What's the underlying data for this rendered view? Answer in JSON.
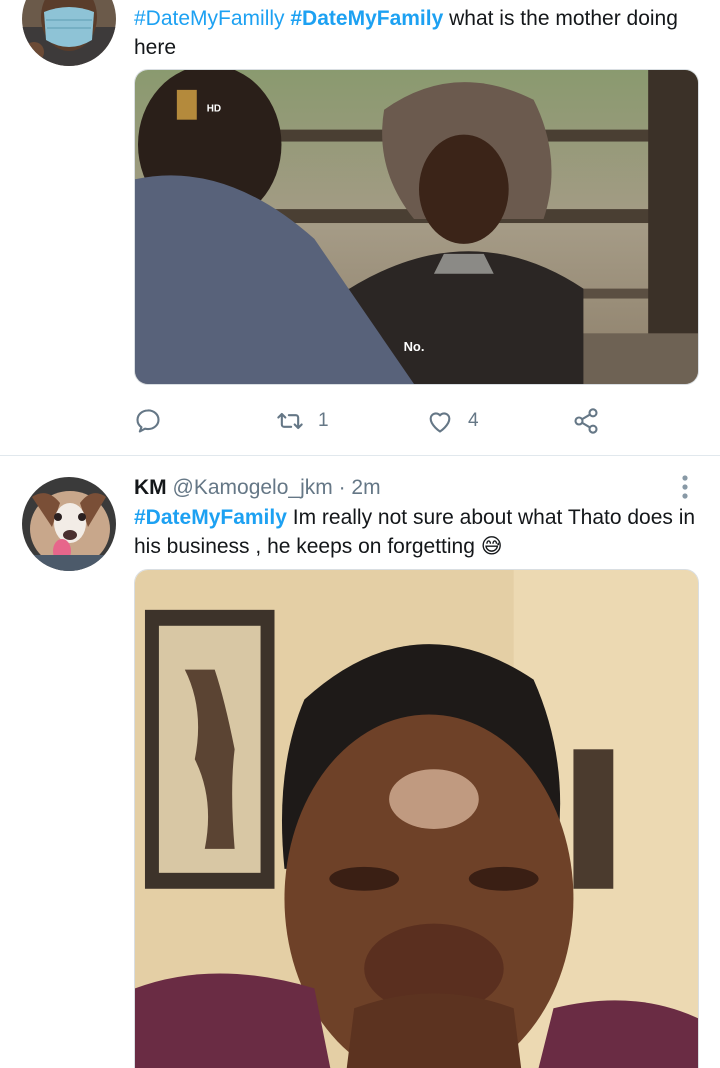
{
  "tweet1": {
    "hashtag_a": "#DateMyFamilly",
    "hashtag_b": "#DateMyFamily",
    "text_rest": " what is the mother doing here",
    "media": {
      "badge": "HD",
      "subtitle": "No."
    },
    "actions": {
      "reply_icon": "reply-icon",
      "retweet_icon": "retweet-icon",
      "retweet_count": "1",
      "like_icon": "heart-icon",
      "like_count": "4",
      "share_icon": "share-icon"
    }
  },
  "tweet2": {
    "name": "KM",
    "handle": "@Kamogelo_jkm",
    "separator": " · ",
    "time": "2m",
    "hashtag": "#DateMyFamily",
    "text_rest": " Im really not sure about what Thato does in his business , he keeps on forgetting",
    "emoji": "😅",
    "more_icon": "more-vertical-icon"
  },
  "colors": {
    "link": "#1da1f2",
    "secondary_text": "#657786",
    "divider": "#e1e8ed"
  }
}
